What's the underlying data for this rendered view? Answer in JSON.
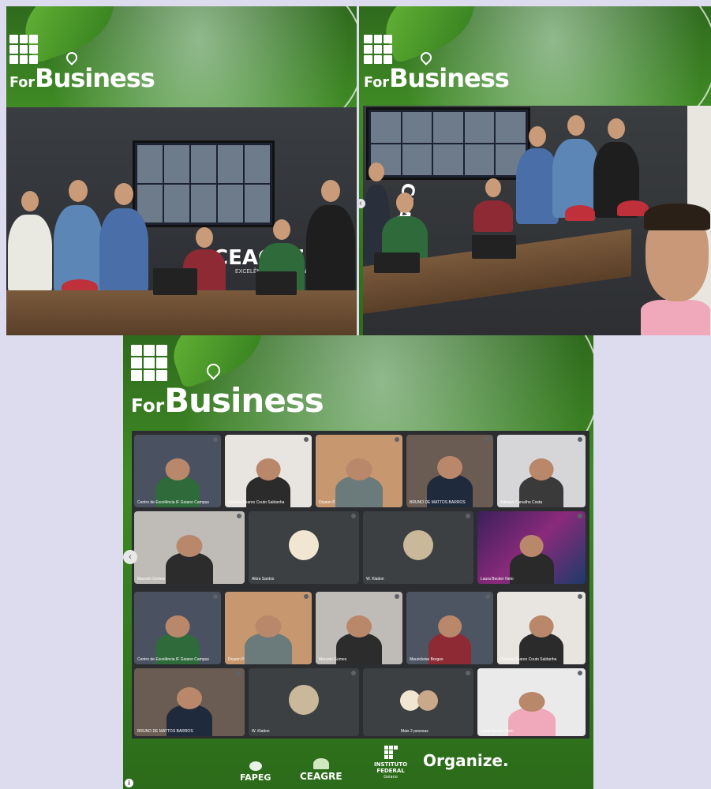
{
  "brand": {
    "logo_for": "For",
    "logo_business": "Business"
  },
  "scene": {
    "banner": "CEAGRE",
    "banner_sub": "EXCELÊNCIA / PRA EXPONENCIAL"
  },
  "meeting": {
    "participants": [
      "Centro de Excelência IF Goiano Campus",
      "Daniela Soares Couto Saldanha",
      "Dryson P.",
      "BRUNO DE MATTOS BARROS",
      "Adriano Carvalho Costa",
      "Marcelo Gomes",
      "Akira Santos",
      "W. Klaiton",
      "Laura Becker Neto",
      "Centro de Excelência IF Goiano Campus",
      "Dryson P.",
      "Marcelo Gomes",
      "Mauricleise Borges",
      "Daniela Soares Couto Saldanha",
      "BRUNO DE MATTOS BARROS",
      "W. Klaiton",
      "Mais 2 pessoas",
      "Laura Becker Neto"
    ]
  },
  "sponsors": {
    "fapeg": "FAPEG",
    "ceagre": "CEAGRE",
    "if_line1": "INSTITUTO",
    "if_line2": "FEDERAL",
    "if_line3": "Goiano",
    "organize": "Organize."
  },
  "nav": {
    "prev": "‹",
    "info": "i"
  },
  "colors": {
    "background": "#dcdcee",
    "green": "#3f8a25",
    "meet_bg": "#2b2d30"
  }
}
